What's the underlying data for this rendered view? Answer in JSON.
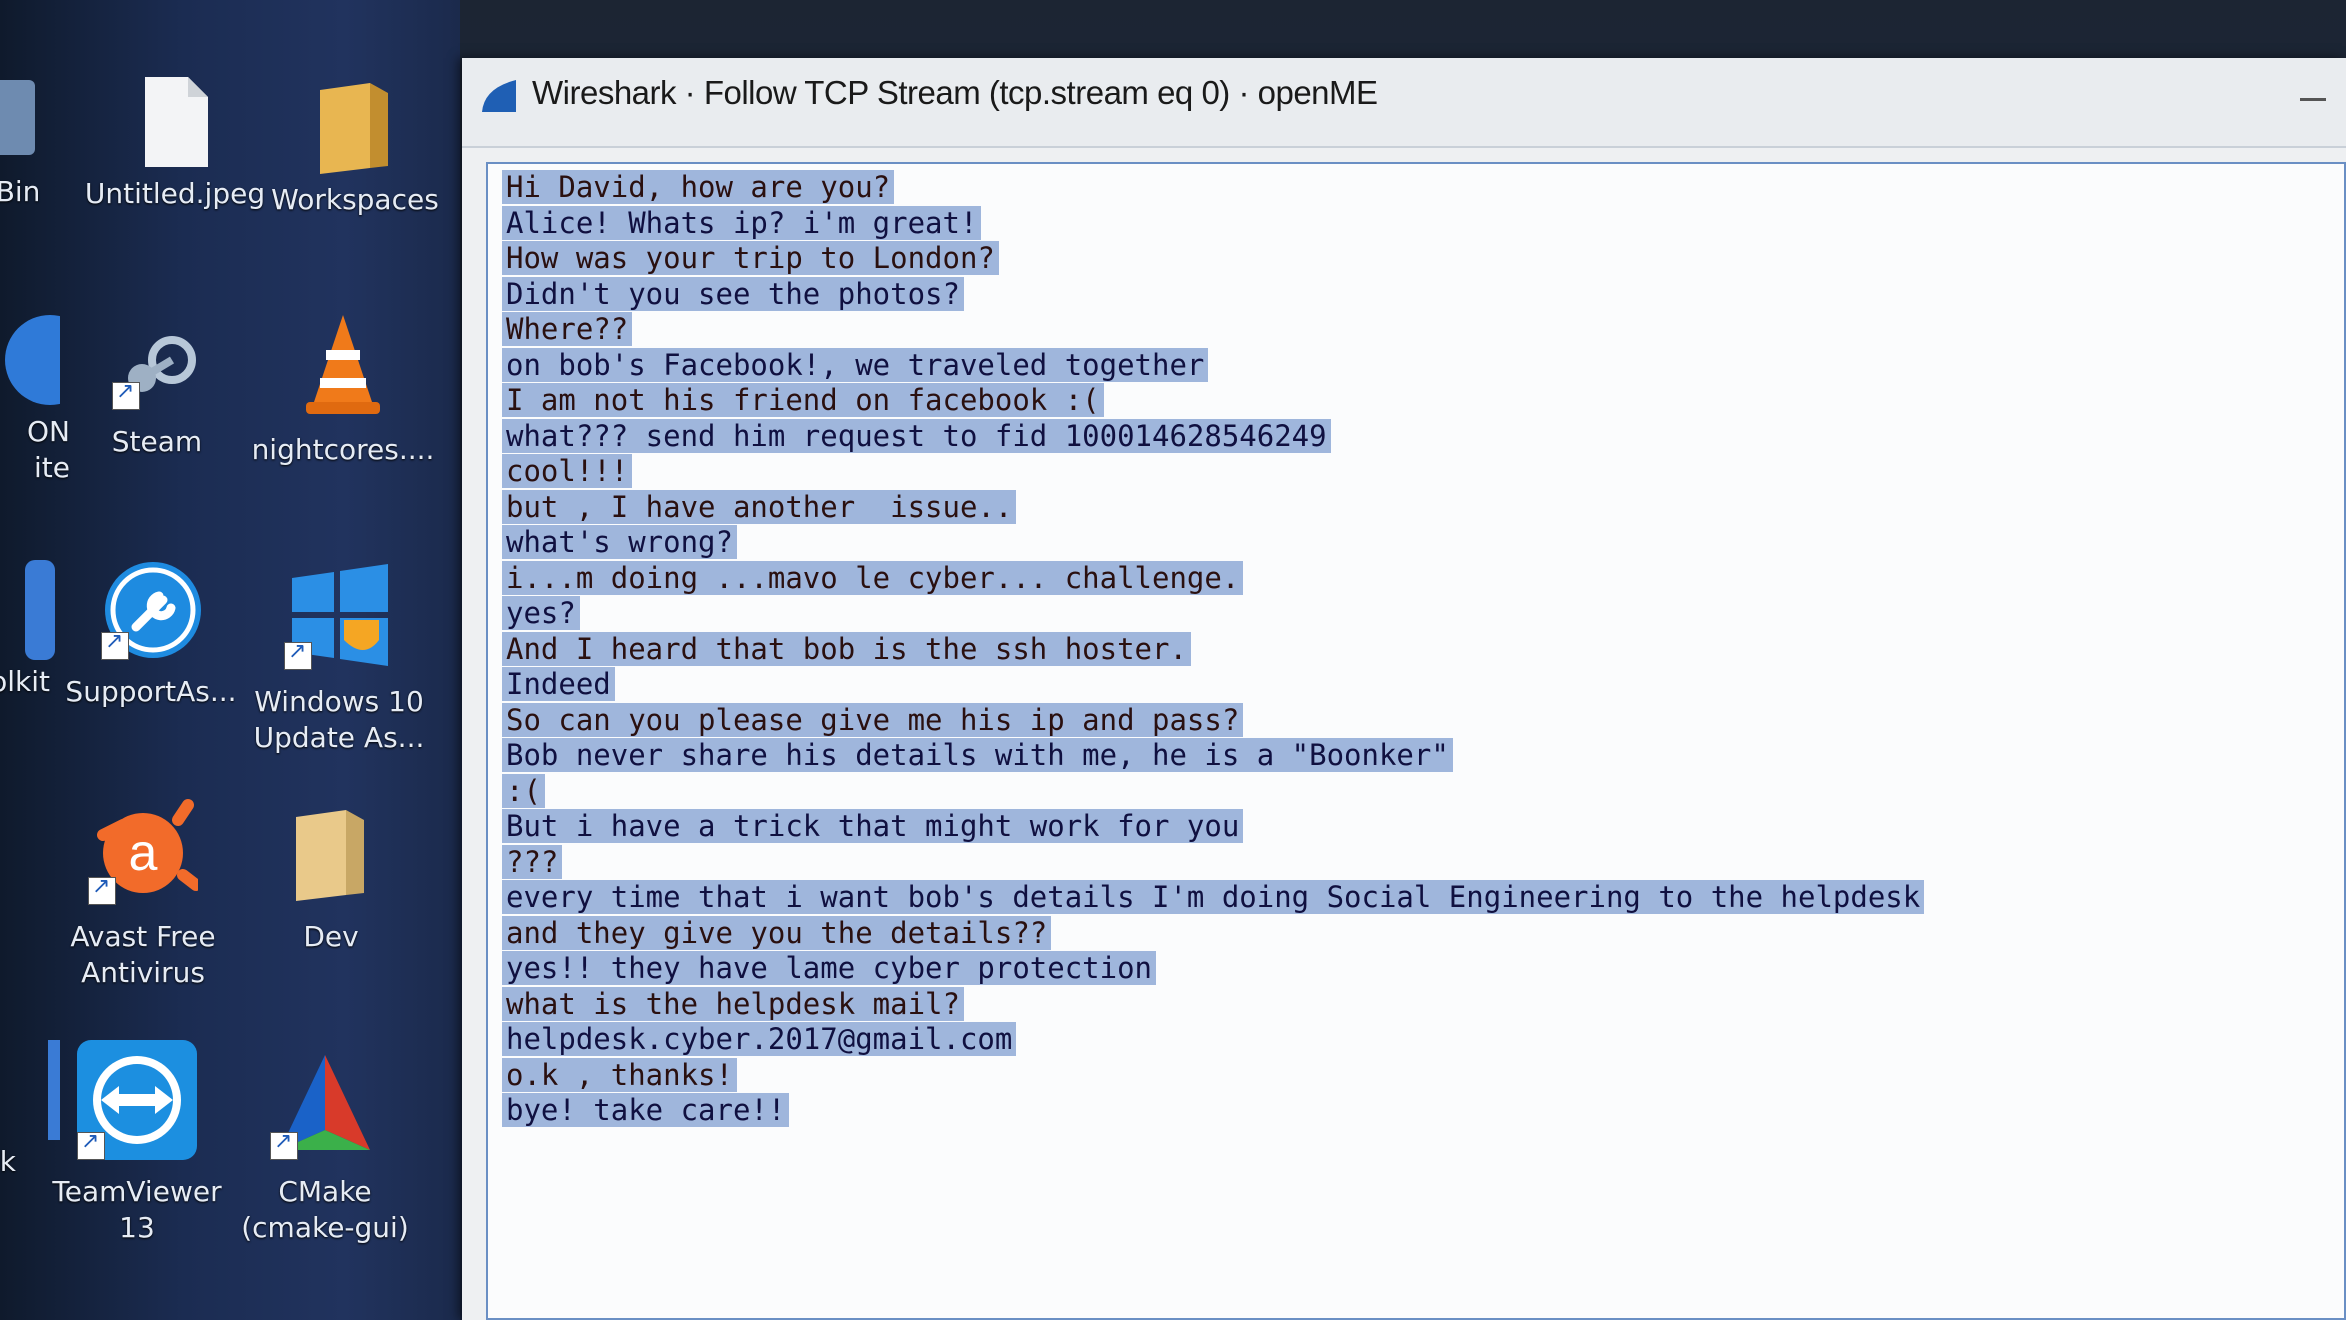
{
  "desktop": {
    "icons": [
      {
        "name": "recycle-bin",
        "label": "e Bin"
      },
      {
        "name": "untitled-jpeg",
        "label": "Untitled.jpeg"
      },
      {
        "name": "workspaces",
        "label": "Workspaces"
      },
      {
        "name": "on-ite",
        "label": "ON\nite"
      },
      {
        "name": "steam",
        "label": "Steam"
      },
      {
        "name": "nightcores",
        "label": "nightcores...."
      },
      {
        "name": "toolkit",
        "label": "olkit"
      },
      {
        "name": "supportassist",
        "label": "SupportAs..."
      },
      {
        "name": "windows10-update",
        "label": "Windows 10\nUpdate As..."
      },
      {
        "name": "avast",
        "label": "Avast Free\nAntivirus"
      },
      {
        "name": "dev",
        "label": "Dev"
      },
      {
        "name": "k",
        "label": "k"
      },
      {
        "name": "teamviewer",
        "label": "TeamViewer\n13"
      },
      {
        "name": "cmake",
        "label": "CMake\n(cmake-gui)"
      }
    ]
  },
  "window": {
    "title": "Wireshark · Follow TCP Stream (tcp.stream eq 0) · openME"
  },
  "stream": [
    {
      "side": "client",
      "sel": true,
      "text": "Hi David, how are you?"
    },
    {
      "side": "server",
      "sel": true,
      "text": "Alice! Whats ip? i'm great!"
    },
    {
      "side": "client",
      "sel": true,
      "text": "How was your trip to London?"
    },
    {
      "side": "server",
      "sel": true,
      "text": "Didn't you see the photos?"
    },
    {
      "side": "client",
      "sel": true,
      "text": "Where??"
    },
    {
      "side": "server",
      "sel": true,
      "text": "on bob's Facebook!, we traveled together"
    },
    {
      "side": "client",
      "sel": true,
      "text": "I am not his friend on facebook :("
    },
    {
      "side": "server",
      "sel": true,
      "text": "what??? send him request to fid 100014628546249"
    },
    {
      "side": "client",
      "sel": true,
      "text": "cool!!!"
    },
    {
      "side": "client",
      "sel": true,
      "text": "but , I have another  issue.."
    },
    {
      "side": "server",
      "sel": true,
      "text": "what's wrong?"
    },
    {
      "side": "client",
      "sel": true,
      "text": "i...m doing ...mavo le cyber... challenge."
    },
    {
      "side": "server",
      "sel": true,
      "text": "yes?"
    },
    {
      "side": "client",
      "sel": true,
      "text": "And I heard that bob is the ssh hoster."
    },
    {
      "side": "server",
      "sel": true,
      "text": "Indeed"
    },
    {
      "side": "client",
      "sel": true,
      "text": "So can you please give me his ip and pass?"
    },
    {
      "side": "server",
      "sel": true,
      "text": "Bob never share his details with me, he is a \"Boonker\""
    },
    {
      "side": "client",
      "sel": true,
      "text": ":("
    },
    {
      "side": "server",
      "sel": true,
      "text": "But i have a trick that might work for you"
    },
    {
      "side": "client",
      "sel": true,
      "text": "???"
    },
    {
      "side": "server",
      "sel": true,
      "text": "every time that i want bob's details I'm doing Social Engineering to the helpdesk"
    },
    {
      "side": "client",
      "sel": true,
      "text": "and they give you the details??"
    },
    {
      "side": "server",
      "sel": true,
      "text": "yes!! they have lame cyber protection"
    },
    {
      "side": "client",
      "sel": true,
      "text": "what is the helpdesk mail?"
    },
    {
      "side": "server",
      "sel": true,
      "text": "helpdesk.cyber.2017@gmail.com"
    },
    {
      "side": "client",
      "sel": true,
      "text": "o.k , thanks!"
    },
    {
      "side": "server",
      "sel": true,
      "text": "bye! take care!!"
    }
  ],
  "colors": {
    "client_text": "#7a1a1a",
    "server_text": "#1a1a7a",
    "selection": "#9fb6dc",
    "window_border": "#6a8fc4"
  }
}
